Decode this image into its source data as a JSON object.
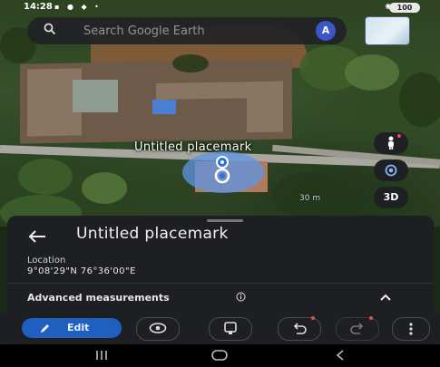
{
  "status_bar": {
    "time": "14:28",
    "battery": "100"
  },
  "search": {
    "placeholder": "Search Google Earth",
    "avatar_letter": "A"
  },
  "map": {
    "placemark_label": "Untitled placemark",
    "distance": "30 m",
    "view_toggle_label": "3D"
  },
  "sheet": {
    "title": "Untitled placemark",
    "location_label": "Location",
    "location_value": "9°08'29\"N 76°36'00\"E",
    "advanced_label": "Advanced measurements"
  },
  "toolbar": {
    "edit_label": "Edit"
  },
  "colors": {
    "accent": "#1f5fbf",
    "sheet_bg": "#1e1f22",
    "placemark_blue": "#5f96e6"
  },
  "icons": [
    "search-icon",
    "pegman-icon",
    "my-location-icon",
    "back-arrow-icon",
    "info-icon",
    "chevron-up-icon",
    "pencil-icon",
    "eye-icon",
    "layers-icon",
    "undo-icon",
    "redo-icon",
    "more-vert-icon",
    "nav-recents-icon",
    "nav-home-icon",
    "nav-back-icon"
  ]
}
